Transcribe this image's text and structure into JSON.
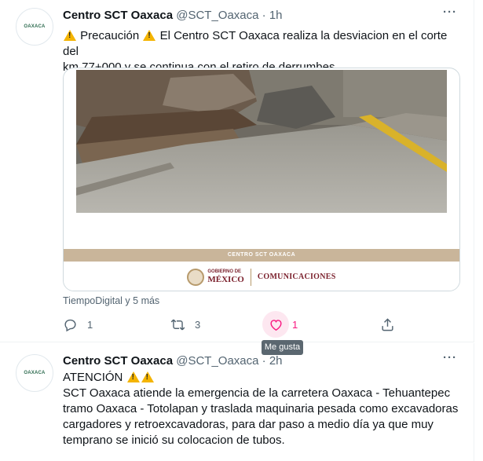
{
  "tweets": [
    {
      "avatar_text": "OAXACA",
      "name": "Centro SCT Oaxaca",
      "handle": "@SCT_Oaxaca",
      "separator": "·",
      "time": "1h",
      "more_label": "···",
      "text_lines": {
        "part1": "Precaución",
        "part2": "El Centro SCT Oaxaca  realiza la desviacion en el corte del",
        "line2": "km 77+000 y se continua con el retiro de derrumbes."
      },
      "media": {
        "banner_text": "CENTRO SCT OAXACA",
        "footer_gob": "GOBIERNO DE",
        "footer_mexico": "MÉXICO",
        "footer_comm": "COMUNICACIONES"
      },
      "retweeted_by": "TiempoDigital y 5 más",
      "reply_count": "1",
      "retweet_count": "3",
      "like_count": "1"
    },
    {
      "avatar_text": "OAXACA",
      "name": "Centro SCT Oaxaca",
      "handle": "@SCT_Oaxaca",
      "separator": "·",
      "time": "2h",
      "more_label": "···",
      "text_lines": {
        "line1": "ATENCIÓN",
        "line2": "SCT Oaxaca atiende la emergencia de la carretera Oaxaca - Tehuantepec",
        "line3": "tramo Oaxaca - Totolapan y traslada maquinaria pesada como excavadoras",
        "line4": "cargadores y retroexcavadoras, para dar paso a medio día ya que muy",
        "line5": "temprano se inició su colocacion de tubos."
      }
    }
  ],
  "tooltip": "Me gusta",
  "colors": {
    "like_accent": "#f91880",
    "muted": "#536471",
    "warning": "#f4b400"
  },
  "icons": [
    "warning-icon",
    "reply-icon",
    "retweet-icon",
    "like-icon",
    "share-icon",
    "more-icon"
  ]
}
